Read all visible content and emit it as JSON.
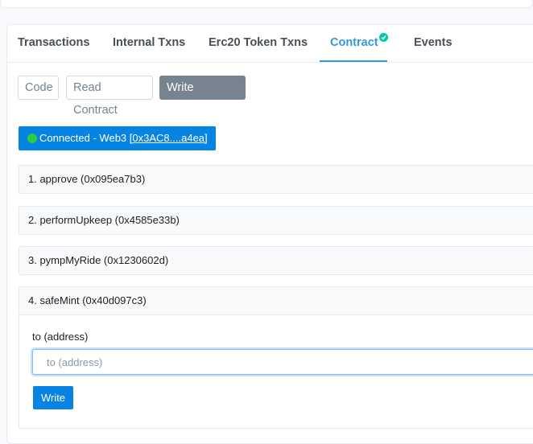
{
  "tabs": {
    "transactions": "Transactions",
    "internal_txns": "Internal Txns",
    "erc20_token_txns": "Erc20 Token Txns",
    "contract": "Contract",
    "events": "Events",
    "active": "Contract"
  },
  "contract_subtabs": {
    "code": "Code",
    "read_contract": "Read Contract",
    "write_contract": "Write Contract",
    "active": "Write Contract"
  },
  "connection": {
    "status": "Connected - Web3",
    "address": "[0x3AC8....a4ea]",
    "status_color": "#2ecc40"
  },
  "functions": [
    {
      "label": "1. approve (0x095ea7b3)"
    },
    {
      "label": "2. performUpkeep (0x4585e33b)"
    },
    {
      "label": "3. pympMyRide (0x1230602d)"
    },
    {
      "label": "4. safeMint (0x40d097c3)"
    }
  ],
  "safe_mint_form": {
    "field_label": "to (address)",
    "field_placeholder": "to (address)",
    "field_value": "",
    "write_button": "Write"
  },
  "colors": {
    "accent": "#3498db",
    "primary_button": "#0784e3",
    "verified_badge": "#00c9a7"
  }
}
